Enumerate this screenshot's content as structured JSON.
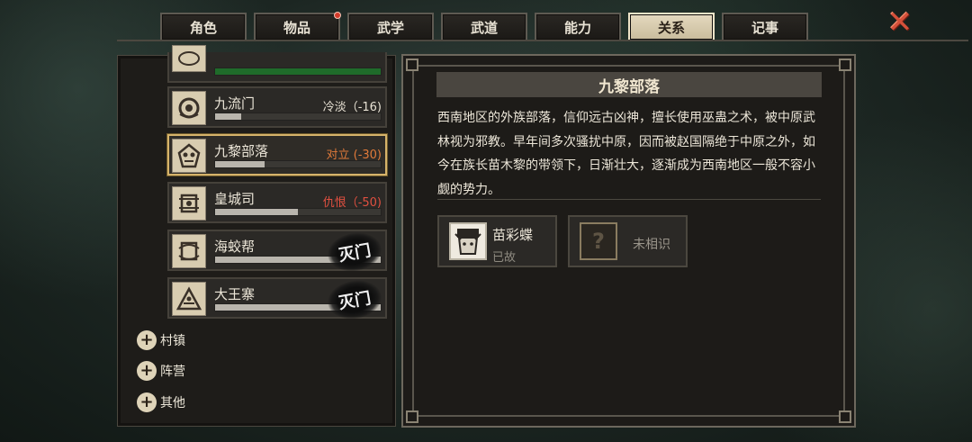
{
  "tabs": [
    {
      "label": "角色",
      "active": false,
      "dot": false
    },
    {
      "label": "物品",
      "active": false,
      "dot": true
    },
    {
      "label": "武学",
      "active": false,
      "dot": false
    },
    {
      "label": "武道",
      "active": false,
      "dot": false
    },
    {
      "label": "能力",
      "active": false,
      "dot": false
    },
    {
      "label": "关系",
      "active": true,
      "dot": false
    },
    {
      "label": "记事",
      "active": false,
      "dot": false
    }
  ],
  "close_symbol": "✕",
  "factions": [
    {
      "name": "九流门",
      "status": "冷淡（-16)",
      "status_type": "cold",
      "relation_fill": 0.16,
      "stamp": "",
      "selected": false
    },
    {
      "name": "九黎部落",
      "status": "对立 (-30)",
      "status_type": "oppose",
      "relation_fill": 0.3,
      "stamp": "",
      "selected": true
    },
    {
      "name": "皇城司",
      "status": "仇恨（-50)",
      "status_type": "hate",
      "relation_fill": 0.5,
      "stamp": "",
      "selected": false
    },
    {
      "name": "海蛟帮",
      "status": "",
      "status_type": "",
      "relation_fill": 1.0,
      "stamp": "灭门",
      "selected": false
    },
    {
      "name": "大王寨",
      "status": "",
      "status_type": "",
      "relation_fill": 1.0,
      "stamp": "灭门",
      "selected": false
    }
  ],
  "categories": [
    {
      "label": "村镇"
    },
    {
      "label": "阵营"
    },
    {
      "label": "其他"
    }
  ],
  "detail": {
    "title": "九黎部落",
    "description": "西南地区的外族部落，信仰远古凶神，擅长使用巫蛊之术，被中原武林视为邪教。早年间多次骚扰中原，因而被赵国隔绝于中原之外，如今在族长苗木黎的带领下，日渐壮大，逐渐成为西南地区一般不容小觑的势力。",
    "members": [
      {
        "name": "苗彩蝶",
        "state": "已故"
      },
      {
        "name": "",
        "state": "未相识",
        "unknown_mark": "?"
      }
    ]
  },
  "colors": {
    "accent_gold": "#d6b36a",
    "status_oppose": "#e07a3a",
    "status_hate": "#e05040",
    "close_red": "#d4503a"
  }
}
